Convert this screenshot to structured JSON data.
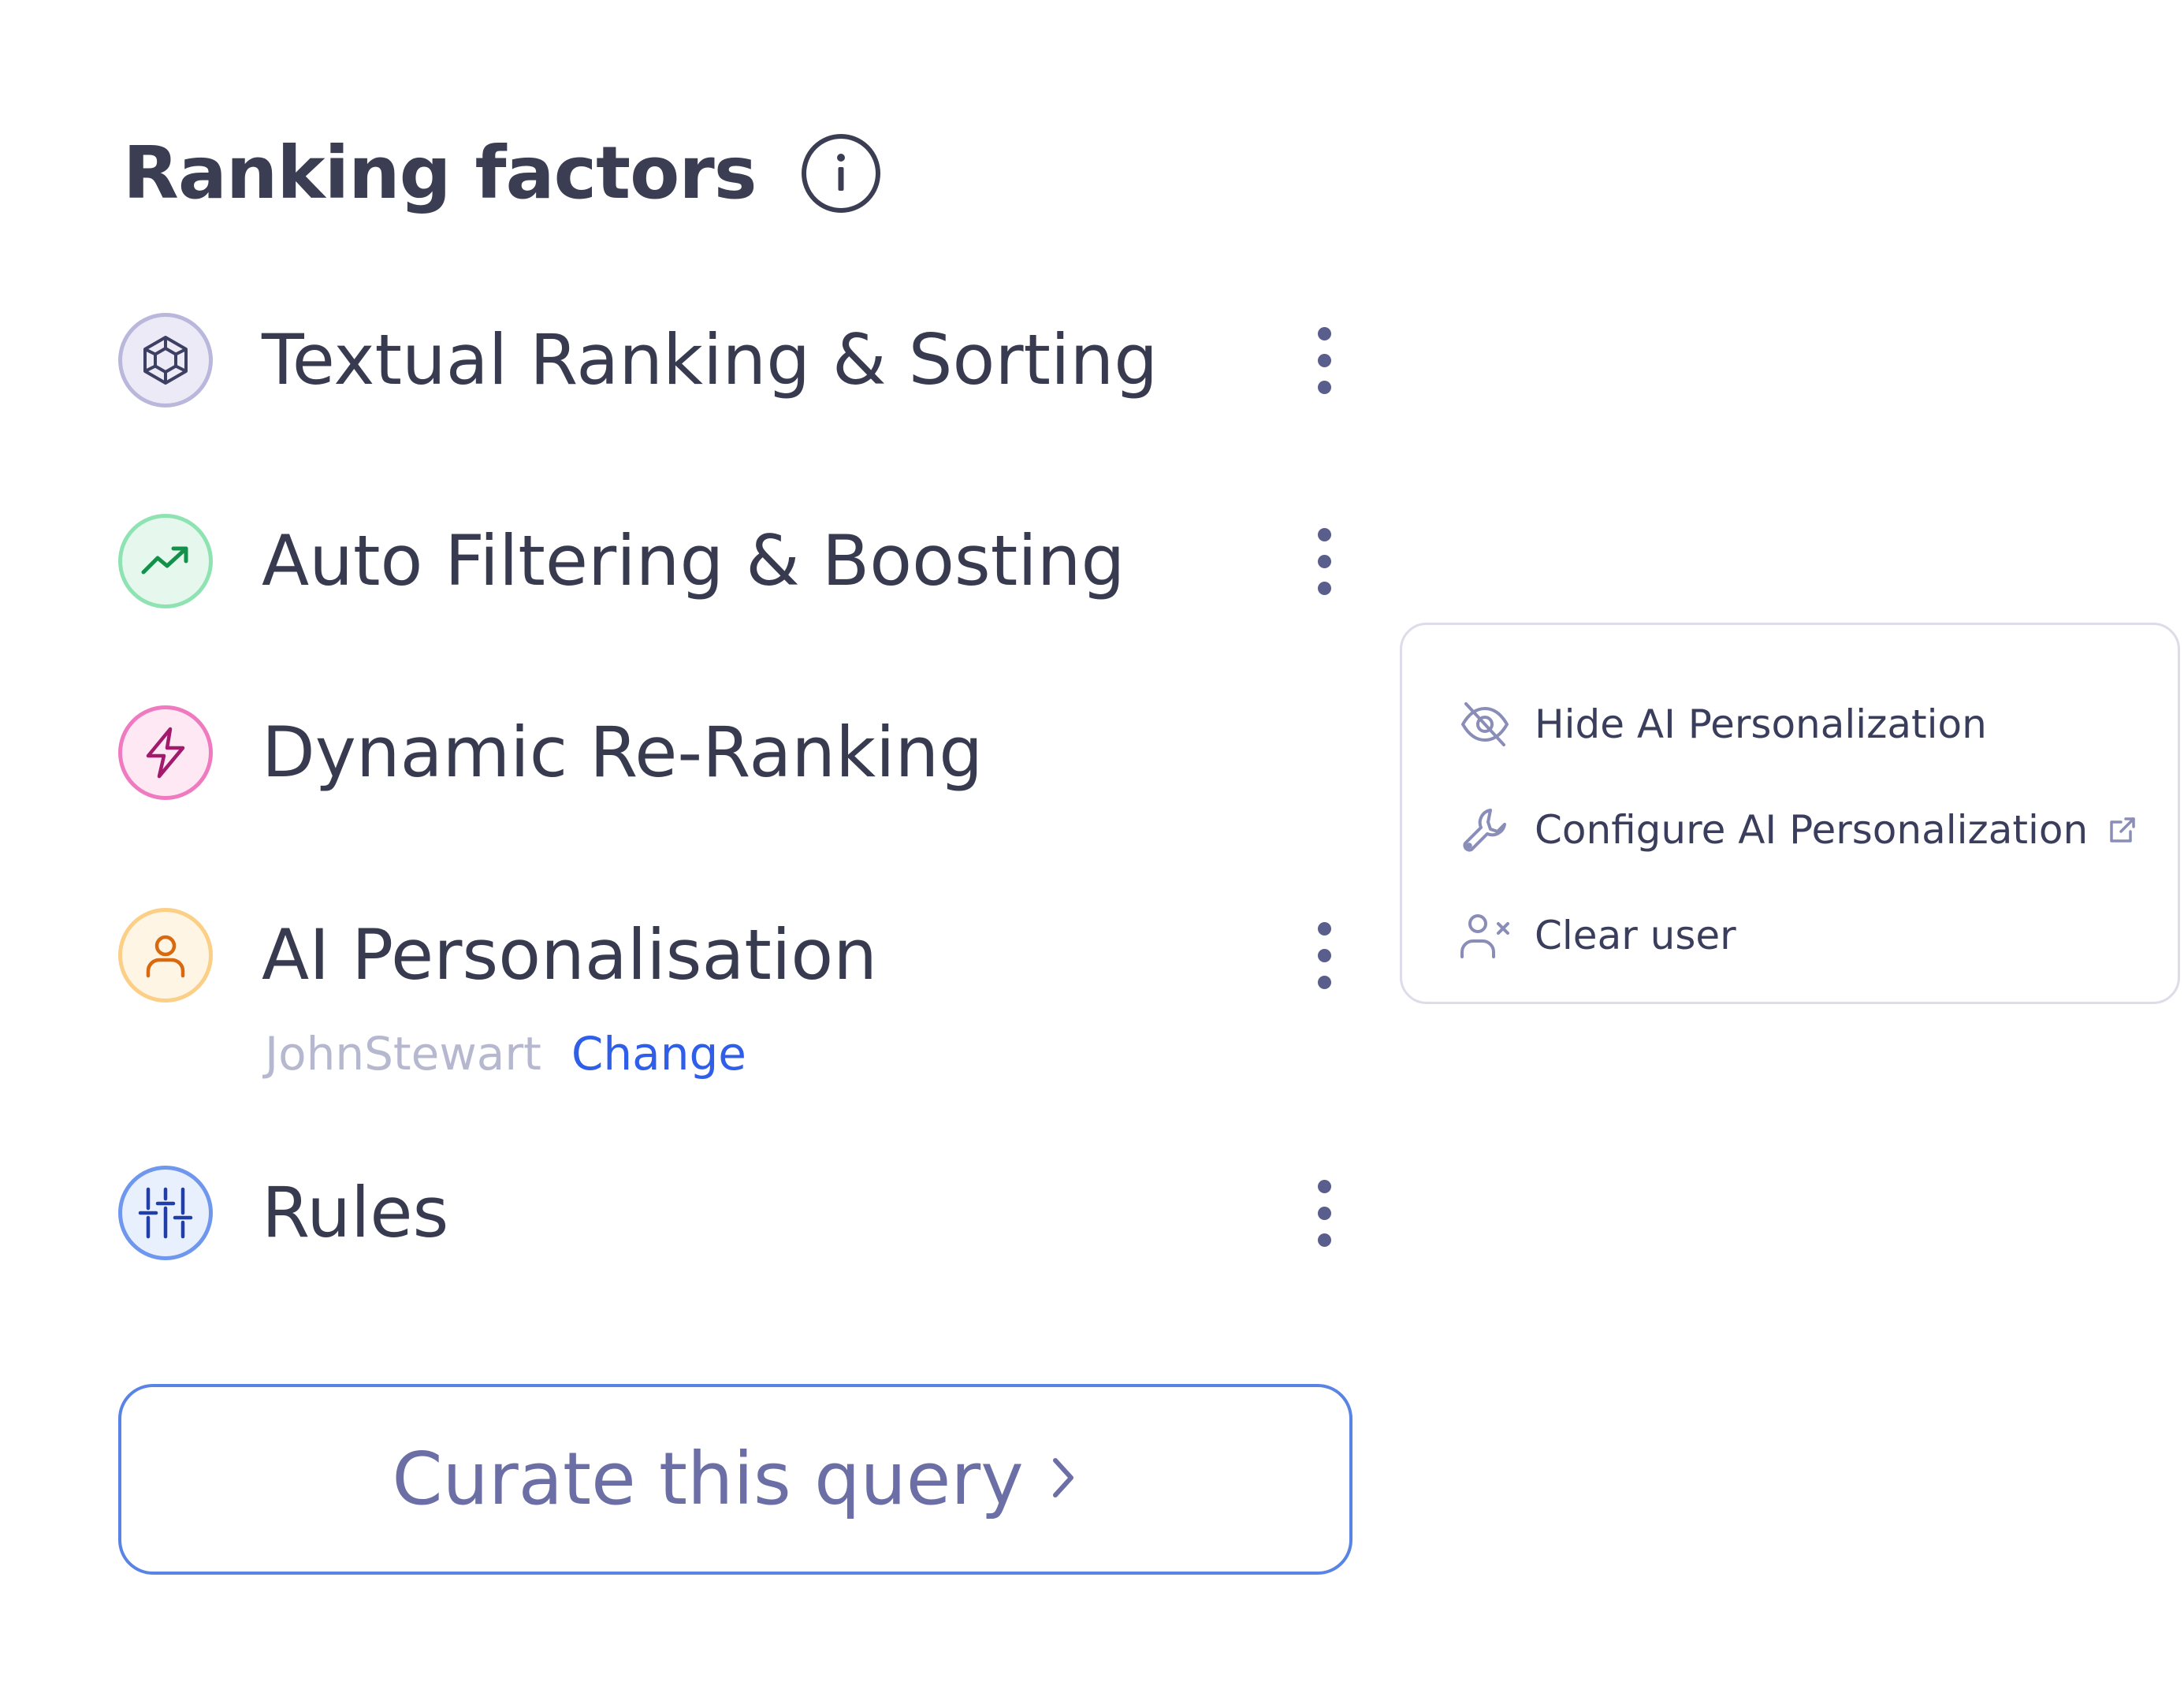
{
  "panel": {
    "title": "Ranking factors",
    "info_icon": "info-circle-icon"
  },
  "factors": [
    {
      "label": "Textual Ranking & Sorting",
      "icon": "cube-icon",
      "accent": "#b9b7db",
      "has_menu": true
    },
    {
      "label": "Auto Filtering & Boosting",
      "icon": "trending-up-icon",
      "accent": "#8fe3b3",
      "has_menu": true
    },
    {
      "label": "Dynamic Re-Ranking",
      "icon": "lightning-icon",
      "accent": "#f07ac0",
      "has_menu": false
    },
    {
      "label": "AI Personalisation",
      "icon": "user-icon",
      "accent": "#fbcf86",
      "has_menu": true
    },
    {
      "label": "Rules",
      "icon": "sliders-icon",
      "accent": "#6f97ee",
      "has_menu": true
    }
  ],
  "personalisation": {
    "user_name": "JohnStewart",
    "change_label": "Change"
  },
  "curate_button": {
    "label": "Curate this query",
    "icon": "chevron-right-icon"
  },
  "context_menu": {
    "items": [
      {
        "label": "Hide AI Personalization",
        "icon": "eye-off-icon"
      },
      {
        "label": "Configure AI Personalization",
        "icon": "wrench-icon",
        "trailing_icon": "external-link-icon"
      },
      {
        "label": "Clear user",
        "icon": "user-remove-icon"
      }
    ]
  },
  "colors": {
    "text": "#3a3d55",
    "link": "#2f5fe8",
    "muted": "#b6b8cf",
    "button_border": "#5a83e6",
    "button_text": "#6b6fa6",
    "kebab": "#5a5e8c"
  }
}
